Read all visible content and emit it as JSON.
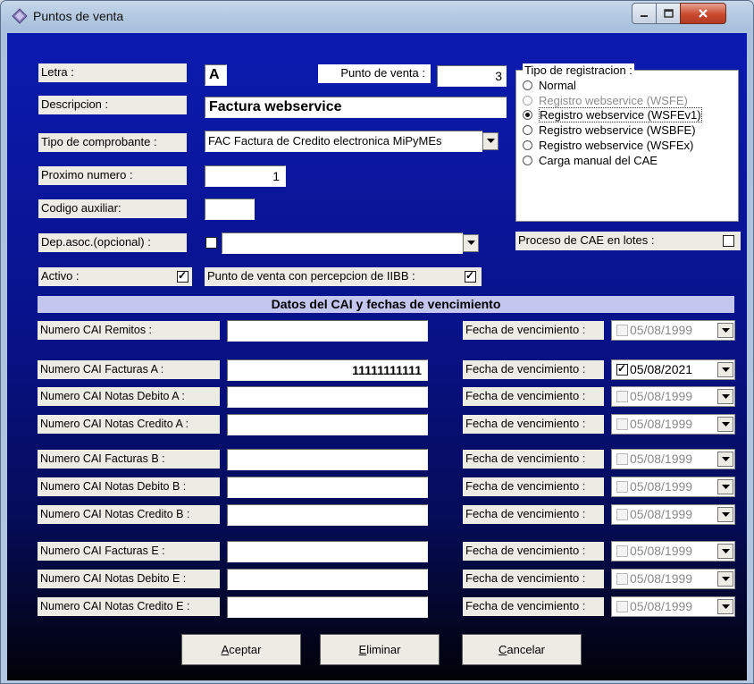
{
  "window": {
    "title": "Puntos de venta"
  },
  "labels": {
    "letra": "Letra :",
    "punto_venta": "Punto de venta :",
    "descripcion": "Descripcion :",
    "tipo_comprobante": "Tipo de comprobante :",
    "proximo_numero": "Proximo numero :",
    "codigo_auxiliar": "Codigo auxiliar:",
    "dep_asoc": "Dep.asoc.(opcional) :",
    "activo": "Activo :",
    "percepcion": "Punto de venta con percepcion de IIBB :",
    "proceso_lotes": "Proceso de CAE en lotes :"
  },
  "values": {
    "letra": "A",
    "punto_venta": "3",
    "descripcion": "Factura webservice",
    "tipo_comprobante": "FAC  Factura de Credito electronica MiPyMEs",
    "proximo_numero": "1",
    "codigo_auxiliar": "",
    "dep_asoc": "",
    "activo": true,
    "percepcion": true,
    "dep_asoc_checked": false,
    "proceso_lotes": false
  },
  "registro": {
    "title": "Tipo de registracion :",
    "options": [
      {
        "label": "Normal",
        "selected": false,
        "disabled": false
      },
      {
        "label": "Registro webservice (WSFE)",
        "selected": false,
        "disabled": true
      },
      {
        "label": "Registro webservice (WSFEv1)",
        "selected": true,
        "disabled": false
      },
      {
        "label": "Registro webservice (WSBFE)",
        "selected": false,
        "disabled": false
      },
      {
        "label": "Registro webservice (WSFEx)",
        "selected": false,
        "disabled": false
      },
      {
        "label": "Carga manual del CAE",
        "selected": false,
        "disabled": false
      }
    ]
  },
  "cai_header": "Datos del CAI y fechas de vencimiento",
  "fecha_label": "Fecha de vencimiento :",
  "cai_rows": [
    {
      "label": "Numero CAI Remitos :",
      "value": "",
      "date": "05/08/1999",
      "checked": false
    },
    {
      "label": "Numero CAI Facturas A :",
      "value": "11111111111",
      "date": "05/08/2021",
      "checked": true
    },
    {
      "label": "Numero CAI Notas Debito A :",
      "value": "",
      "date": "05/08/1999",
      "checked": false
    },
    {
      "label": "Numero CAI Notas Credito A :",
      "value": "",
      "date": "05/08/1999",
      "checked": false
    },
    {
      "label": "Numero CAI Facturas B :",
      "value": "",
      "date": "05/08/1999",
      "checked": false
    },
    {
      "label": "Numero CAI Notas Debito B :",
      "value": "",
      "date": "05/08/1999",
      "checked": false
    },
    {
      "label": "Numero CAI Notas Credito B :",
      "value": "",
      "date": "05/08/1999",
      "checked": false
    },
    {
      "label": "Numero CAI Facturas E :",
      "value": "",
      "date": "05/08/1999",
      "checked": false
    },
    {
      "label": "Numero CAI Notas Debito E :",
      "value": "",
      "date": "05/08/1999",
      "checked": false
    },
    {
      "label": "Numero CAI Notas Credito E :",
      "value": "",
      "date": "05/08/1999",
      "checked": false
    }
  ],
  "buttons": {
    "aceptar": {
      "accel": "A",
      "rest": "ceptar"
    },
    "eliminar": {
      "accel": "E",
      "rest": "liminar"
    },
    "cancelar": {
      "accel": "C",
      "rest": "ancelar"
    }
  }
}
